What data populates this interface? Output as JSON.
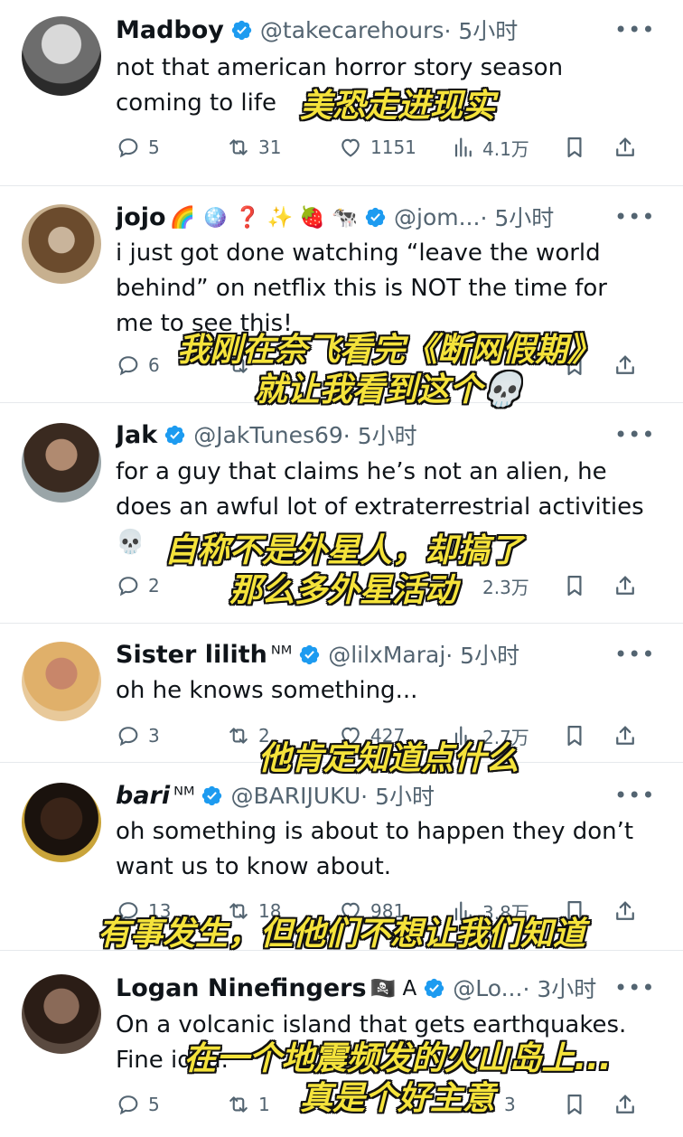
{
  "colors": {
    "verified": "#1d9bf0",
    "muted": "#536471",
    "text": "#0f1419",
    "caption": "#f5e33b"
  },
  "tweets": [
    {
      "name": "Madboy",
      "emojis": "",
      "handle": "@takecarehours",
      "time": "· 5小时",
      "text": "not that american horror story season coming to life",
      "replies": "5",
      "retweets": "31",
      "likes": "1151",
      "views": "4.1万",
      "caption": "美恐走进现实"
    },
    {
      "name": "jojo",
      "emojis": "🌈 🪩 ❓ ✨ 🍓 🐄",
      "handle": "@jom...",
      "time": "· 5小时",
      "text": "i just got done watching “leave the world behind” on netflix this is NOT the time for me to see this!",
      "replies": "6",
      "retweets": "",
      "likes": "",
      "views": "",
      "caption": "我刚在奈飞看完《断网假期》\n就让我看到这个💀"
    },
    {
      "name": "Jak",
      "emojis": "",
      "handle": "@JakTunes69",
      "time": "· 5小时",
      "text": "for a guy that claims he’s not an alien, he does an awful lot of extraterrestrial activities 💀",
      "replies": "2",
      "retweets": "",
      "likes": "",
      "views": "2.3万",
      "caption": "自称不是外星人，却搞了\n那么多外星活动"
    },
    {
      "name": "Sister lilith",
      "emojis": "ᴺᴹ",
      "handle": "@lilxMaraj",
      "time": "· 5小时",
      "text": "oh he knows something...",
      "replies": "3",
      "retweets": "2",
      "likes": "427",
      "views": "2.7万",
      "caption": "他肯定知道点什么"
    },
    {
      "name": "bari",
      "emojis": "ᴺᴹ",
      "handle": "@BARIJUKU",
      "time": "· 5小时",
      "text": "oh something is about to happen they don’t want us to know about.",
      "replies": "13",
      "retweets": "18",
      "likes": "981",
      "views": "3.8万",
      "caption": "有事发生，但他们不想让我们知道"
    },
    {
      "name": "Logan Ninefingers",
      "emojis": "🏴‍☠️ A",
      "handle": "@Lo...",
      "time": "· 3小时",
      "text": "On a volcanic island that gets earthquakes. Fine idea.",
      "replies": "5",
      "retweets": "1",
      "likes": "",
      "views": "3",
      "caption": "在一个地震频发的火山岛上...\n真是个好主意"
    }
  ]
}
